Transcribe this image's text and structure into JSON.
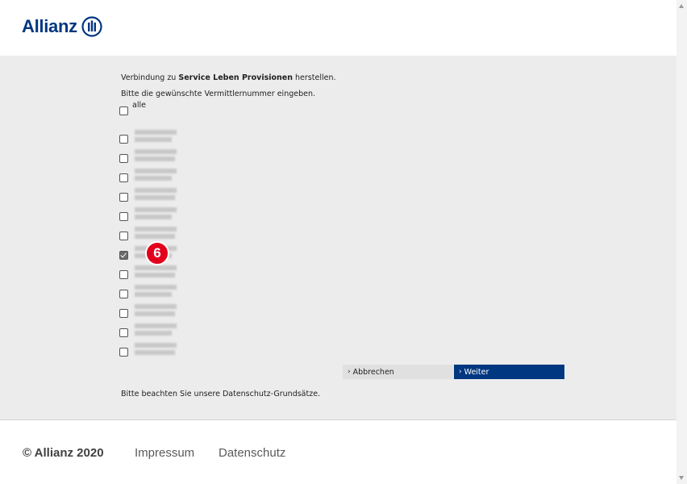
{
  "brand": {
    "name": "Allianz",
    "color": "#003781"
  },
  "intro": {
    "prefix": "Verbindung zu ",
    "service": "Service Leben Provisionen",
    "suffix": " herstellen."
  },
  "instruction": "Bitte die gewünschte Vermittlernummer eingeben.",
  "select_all": {
    "label": "alle",
    "checked": false
  },
  "agent_numbers": [
    {
      "checked": false,
      "redacted": true
    },
    {
      "checked": false,
      "redacted": true
    },
    {
      "checked": false,
      "redacted": true
    },
    {
      "checked": false,
      "redacted": true
    },
    {
      "checked": false,
      "redacted": true
    },
    {
      "checked": false,
      "redacted": true
    },
    {
      "checked": true,
      "redacted": true
    },
    {
      "checked": false,
      "redacted": true
    },
    {
      "checked": false,
      "redacted": true
    },
    {
      "checked": false,
      "redacted": true
    },
    {
      "checked": false,
      "redacted": true
    },
    {
      "checked": false,
      "redacted": true
    }
  ],
  "step_marker": "6",
  "buttons": {
    "cancel": "Abbrechen",
    "next": "Weiter",
    "chevron": "›"
  },
  "privacy_note": "Bitte beachten Sie unsere Datenschutz-Grundsätze.",
  "footer": {
    "copyright": "© Allianz 2020",
    "impressum": "Impressum",
    "datenschutz": "Datenschutz"
  },
  "colors": {
    "accent": "#003781",
    "marker": "#e3001b",
    "content_bg": "#ececec"
  }
}
